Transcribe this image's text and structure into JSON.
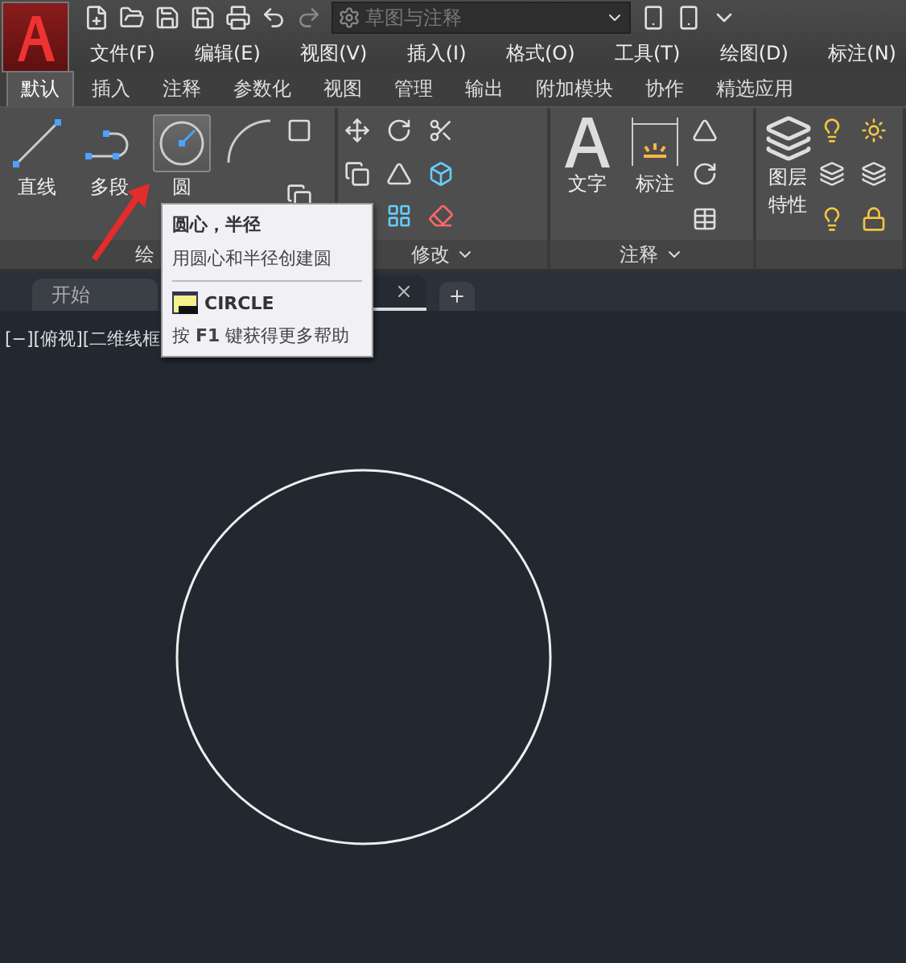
{
  "quick_access": {
    "workspace": "草图与注释"
  },
  "menu": [
    "文件(F)",
    "编辑(E)",
    "视图(V)",
    "插入(I)",
    "格式(O)",
    "工具(T)",
    "绘图(D)",
    "标注(N)"
  ],
  "ribbon_tabs": [
    {
      "label": "默认",
      "selected": true
    },
    {
      "label": "插入",
      "selected": false
    },
    {
      "label": "注释",
      "selected": false
    },
    {
      "label": "参数化",
      "selected": false
    },
    {
      "label": "视图",
      "selected": false
    },
    {
      "label": "管理",
      "selected": false
    },
    {
      "label": "输出",
      "selected": false
    },
    {
      "label": "附加模块",
      "selected": false
    },
    {
      "label": "协作",
      "selected": false
    },
    {
      "label": "精选应用",
      "selected": false
    }
  ],
  "draw_panel": {
    "title": "绘",
    "tools": [
      {
        "label": "直线",
        "selected": false
      },
      {
        "label": "多段",
        "selected": false
      },
      {
        "label": "圆",
        "selected": true
      }
    ]
  },
  "modify_panel": {
    "title": "修改"
  },
  "annotation_panel": {
    "title": "注释",
    "tools": [
      "文字",
      "标注"
    ]
  },
  "layers_panel": {
    "tools": [
      "图层特性"
    ]
  },
  "doc_tabs": [
    {
      "label": "开始",
      "selected": false
    }
  ],
  "viewport_label": "[−][俯视][二维线框",
  "tooltip": {
    "title": "圆心，半径",
    "description": "用圆心和半径创建圆",
    "command": "CIRCLE",
    "help": "按 **F1** 键获得更多帮助"
  }
}
